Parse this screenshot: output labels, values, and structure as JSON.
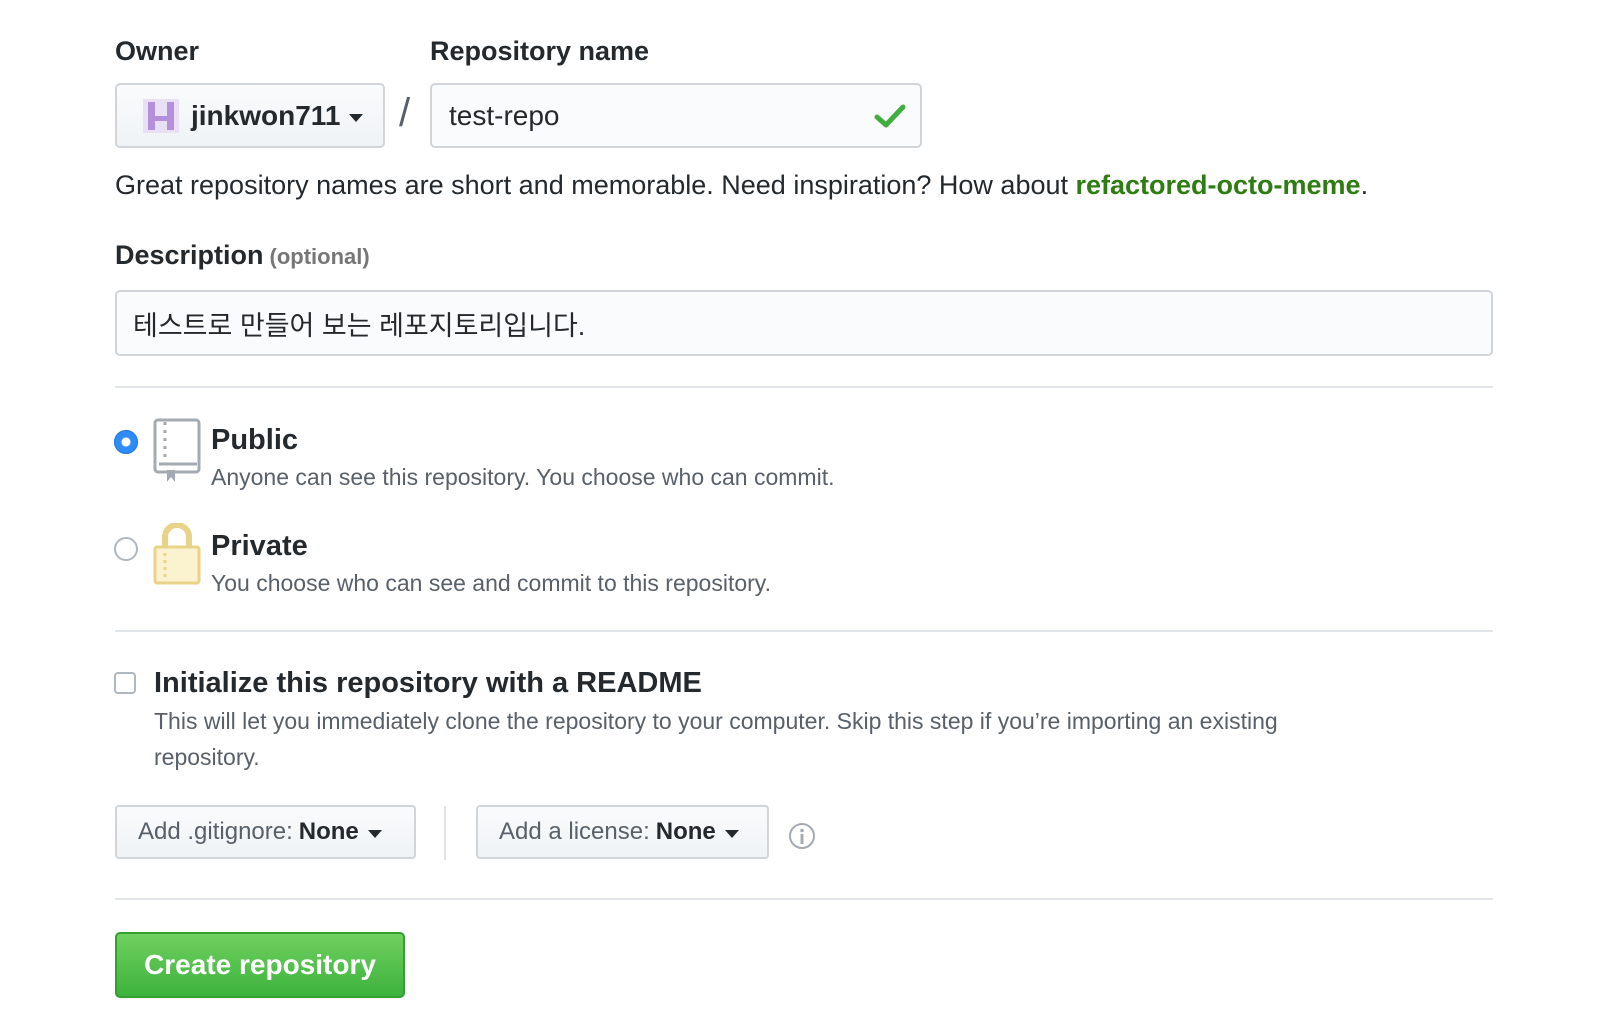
{
  "owner": {
    "label": "Owner",
    "value": "jinkwon711"
  },
  "repo_name": {
    "label": "Repository name",
    "value": "test-repo",
    "separator": "/"
  },
  "hint": {
    "text": "Great repository names are short and memorable. Need inspiration? How about ",
    "suggestion": "refactored-octo-meme",
    "end": "."
  },
  "description": {
    "label": "Description",
    "optional": "(optional)",
    "value": "테스트로 만들어 보는 레포지토리입니다."
  },
  "visibility": {
    "selected": "public",
    "public": {
      "title": "Public",
      "desc": "Anyone can see this repository. You choose who can commit."
    },
    "private": {
      "title": "Private",
      "desc": "You choose who can see and commit to this repository."
    }
  },
  "readme": {
    "checked": false,
    "title": "Initialize this repository with a README",
    "desc_line1": "This will let you immediately clone the repository to your computer. Skip this step if you’re importing an existing",
    "desc_line2": "repository."
  },
  "gitignore": {
    "label": "Add .gitignore:",
    "value": "None"
  },
  "license": {
    "label": "Add a license:",
    "value": "None"
  },
  "create_button": "Create repository",
  "colors": {
    "accent_green": "#3cb23c",
    "suggestion_green": "#2f7d12",
    "radio_blue": "#2f8bf5"
  }
}
